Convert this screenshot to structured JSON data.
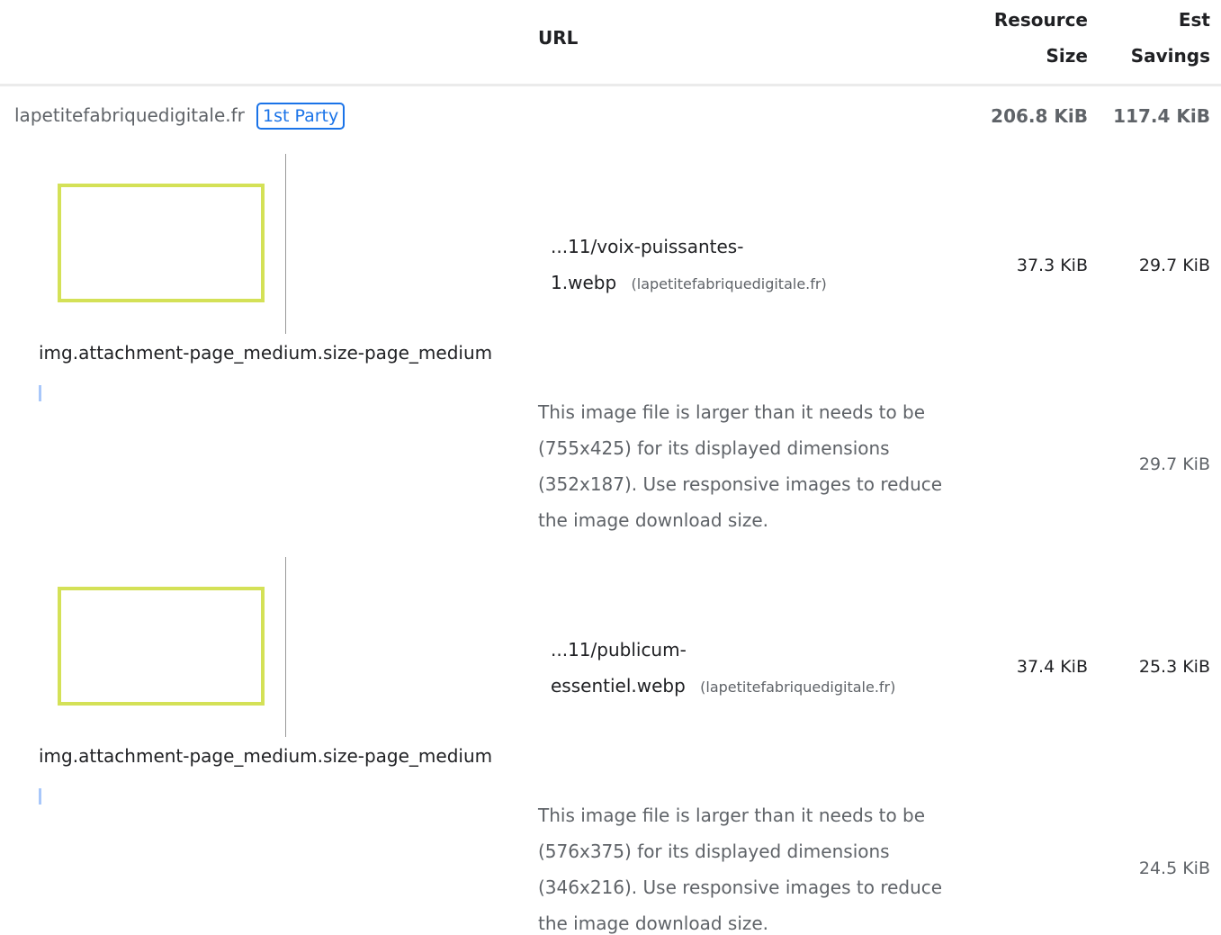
{
  "header": {
    "url": "URL",
    "resource_size_line1": "Resource",
    "resource_size_line2": "Size",
    "est_savings_line1": "Est",
    "est_savings_line2": "Savings"
  },
  "group": {
    "origin": "lapetitefabriquedigitale.fr",
    "badge": "1st Party",
    "resource_size": "206.8 KiB",
    "est_savings": "117.4 KiB"
  },
  "items": [
    {
      "url_line1": "...11/voix-puissantes-",
      "url_line2": "1.webp",
      "origin": "(lapetitefabriquedigitale.fr)",
      "resource_size": "37.3 KiB",
      "est_savings": "29.7 KiB",
      "selector": "img.attachment-page_medium.size-page_medium",
      "desc_lines": [
        "This image file is larger than it needs to be",
        "(755x425) for its displayed dimensions",
        "(352x187). Use responsive images to reduce",
        "the image download size."
      ],
      "sub_savings": "29.7 KiB"
    },
    {
      "url_line1": "...11/publicum-",
      "url_line2": "essentiel.webp",
      "origin": "(lapetitefabriquedigitale.fr)",
      "resource_size": "37.4 KiB",
      "est_savings": "25.3 KiB",
      "selector": "img.attachment-page_medium.size-page_medium",
      "desc_lines": [
        "This image file is larger than it needs to be",
        "(576x375) for its displayed dimensions",
        "(346x216). Use responsive images to reduce",
        "the image download size."
      ],
      "sub_savings": "24.5 KiB"
    }
  ],
  "colors": {
    "accent": "#1a73e8",
    "thumb_border": "#d4e157"
  }
}
